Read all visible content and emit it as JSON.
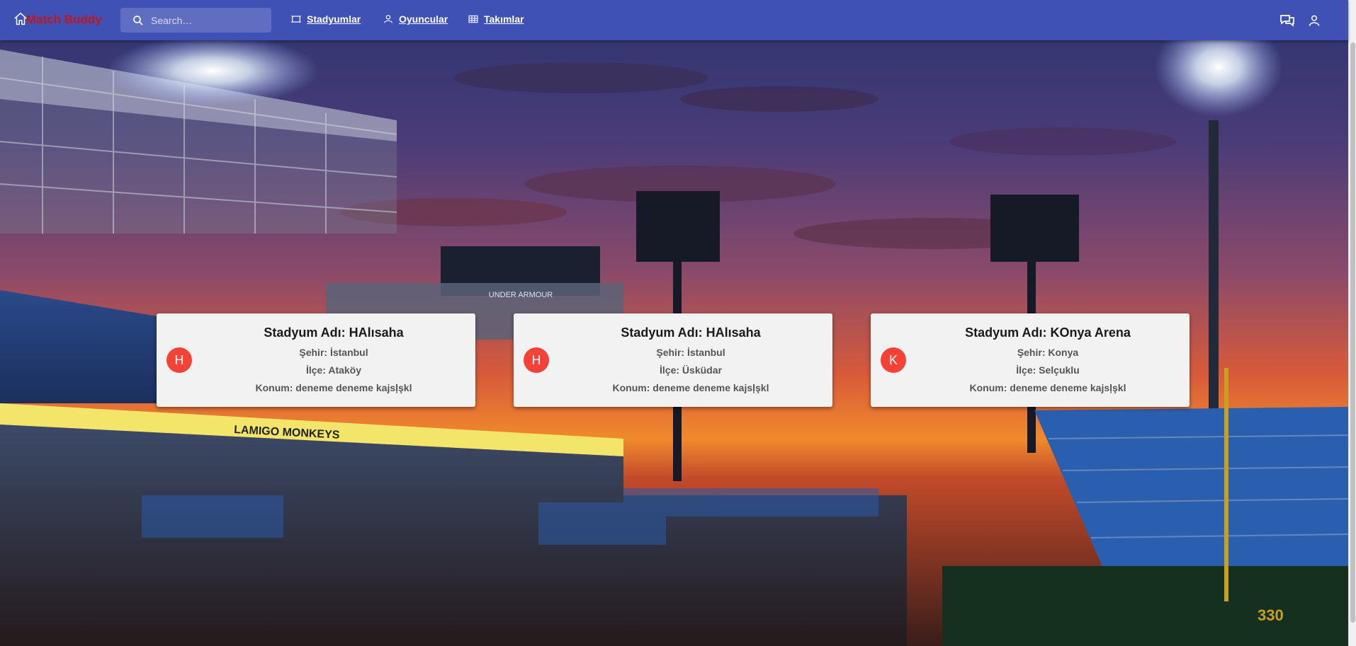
{
  "app": {
    "brand": "Match Buddy"
  },
  "search": {
    "placeholder": "Search…",
    "value": ""
  },
  "nav": {
    "stadiums": "Stadyumlar",
    "players": "Oyuncular",
    "teams": "Takımlar"
  },
  "icons": {
    "home": "home-icon",
    "search": "search-icon",
    "stadiums": "stadium-icon",
    "players": "person-icon",
    "teams": "table-icon",
    "chat": "chat-icon",
    "account": "account-icon"
  },
  "colors": {
    "appbar": "#3f51b5",
    "brand": "#c2161b",
    "avatar": "#f44336",
    "card": "#f2f2f2"
  },
  "scene": {
    "banner": "LAMIGO MONKEYS",
    "billboard": "UNDER ARMOUR",
    "field_number": "330"
  },
  "stadiums": [
    {
      "avatar": "H",
      "title": "Stadyum Adı: HAlısaha",
      "city": "Şehir: İstanbul",
      "district": "İlçe: Ataköy",
      "location": "Konum: deneme deneme kajsļşkl"
    },
    {
      "avatar": "H",
      "title": "Stadyum Adı: HAlısaha",
      "city": "Şehir: İstanbul",
      "district": "İlçe: Üsküdar",
      "location": "Konum: deneme deneme kajsļşkl"
    },
    {
      "avatar": "K",
      "title": "Stadyum Adı: KOnya Arena",
      "city": "Şehir: Konya",
      "district": "İlçe: Selçuklu",
      "location": "Konum: deneme deneme kajsļşkl"
    }
  ]
}
